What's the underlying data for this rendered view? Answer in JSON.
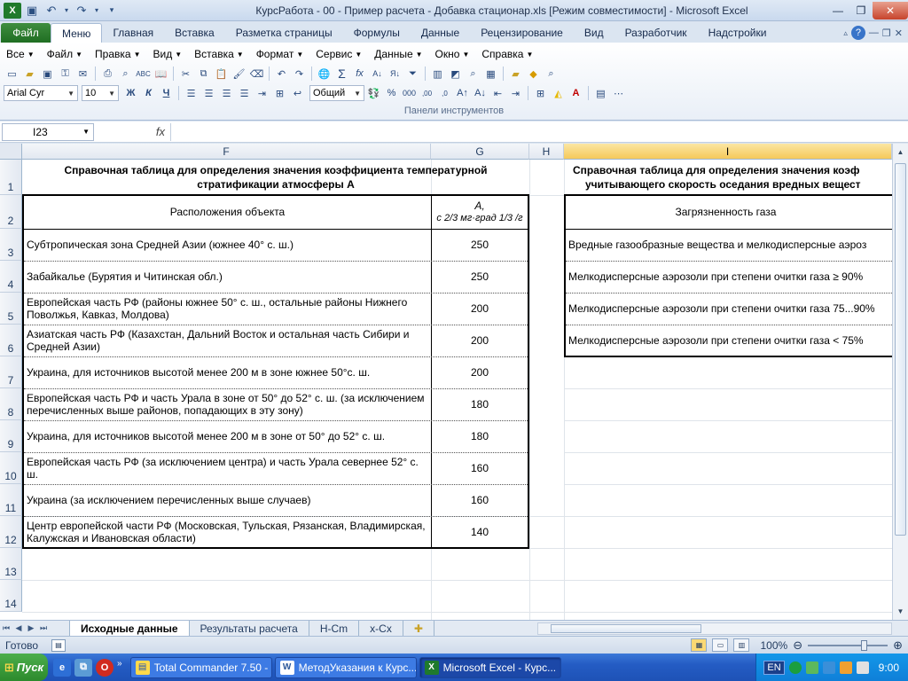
{
  "window": {
    "title": "КурсРабота - 00 - Пример расчета - Добавка стационар.xls  [Режим совместимости]  -  Microsoft Excel"
  },
  "ribbon_tabs": {
    "file": "Файл",
    "items": [
      "Меню",
      "Главная",
      "Вставка",
      "Разметка страницы",
      "Формулы",
      "Данные",
      "Рецензирование",
      "Вид",
      "Разработчик",
      "Надстройки"
    ]
  },
  "menu_row": [
    "Все",
    "Файл",
    "Правка",
    "Вид",
    "Вставка",
    "Формат",
    "Сервис",
    "Данные",
    "Окно",
    "Справка"
  ],
  "toolbar": {
    "font_name": "Arial Cyr",
    "font_size": "10",
    "bold": "Ж",
    "italic": "К",
    "underline": "Ч",
    "number_format": "Общий",
    "group_label": "Панели инструментов"
  },
  "formula_bar": {
    "name_box": "I23",
    "fx": "fx",
    "formula": ""
  },
  "columns": [
    "F",
    "G",
    "H",
    "I"
  ],
  "rows": [
    "1",
    "2",
    "3",
    "4",
    "5",
    "6",
    "7",
    "8",
    "9",
    "10",
    "11",
    "12",
    "13",
    "14"
  ],
  "left_table": {
    "title": "Справочная таблица для определения значения коэффициента температурной стратификации атмосферы A",
    "header_location": "Расположения объекта",
    "header_a": "A,",
    "header_unit": "с 2/3 мг·град 1/3 /г",
    "rows": [
      {
        "location": "Субтропическая зона Средней Азии (южнее 40° с. ш.)",
        "value": "250"
      },
      {
        "location": "Забайкалье (Бурятия и Читинская обл.)",
        "value": "250"
      },
      {
        "location": "Европейская часть РФ (районы южнее 50° с. ш., остальные районы Нижнего Поволжья, Кавказ, Молдова)",
        "value": "200"
      },
      {
        "location": "Азиатская часть РФ (Казахстан, Дальний Восток и остальная часть Сибири и Средней Азии)",
        "value": "200"
      },
      {
        "location": "Украина, для источников высотой менее 200 м в зоне южнее 50°с. ш.",
        "value": "200"
      },
      {
        "location": "Европейская часть РФ и часть Урала в зоне от 50° до 52° с. ш. (за исключением перечисленных выше районов, попадающих в эту зону)",
        "value": "180"
      },
      {
        "location": "Украина, для источников высотой менее 200 м в зоне от 50° до 52° с. ш.",
        "value": "180"
      },
      {
        "location": "Европейская часть РФ (за исключением центра) и часть Урала севернее 52° с. ш.",
        "value": "160"
      },
      {
        "location": "Украина (за исключением перечисленных выше случаев)",
        "value": "160"
      },
      {
        "location": "Центр европейской части РФ (Московская, Тульская, Рязанская, Владимирская, Калужская и Ивановская области)",
        "value": "140"
      }
    ]
  },
  "right_table": {
    "title_line1": "Справочная таблица для определения значения коэф",
    "title_line2": "учитывающего скорость оседания вредных вещест",
    "header": "Загрязненность газа",
    "rows": [
      "Вредные газообразные вещества и мелкодисперсные аэроз",
      "Мелкодисперсные аэрозоли при степени очитки газа ≥ 90%",
      "Мелкодисперсные аэрозоли при степени очитки газа 75...90%",
      "Мелкодисперсные аэрозоли при степени очитки газа < 75%"
    ]
  },
  "sheet_tabs": [
    "Исходные данные",
    "Результаты расчета",
    "Н-Cm",
    "x-Cx"
  ],
  "status": {
    "ready": "Готово",
    "zoom": "100%"
  },
  "taskbar": {
    "start": "Пуск",
    "tasks": [
      "Total Commander 7.50 - ...",
      "МетодУказания к Курс...",
      "Microsoft Excel - Курс..."
    ],
    "lang": "EN",
    "clock": "9:00"
  }
}
